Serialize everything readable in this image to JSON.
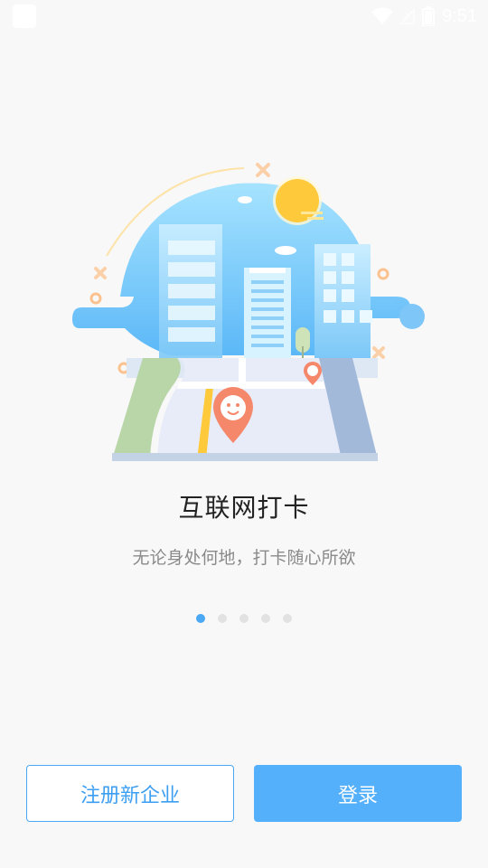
{
  "status_bar": {
    "time": "9:51",
    "icons": [
      "app-icon",
      "wifi-icon",
      "no-signal-icon",
      "battery-icon"
    ]
  },
  "onboarding": {
    "illustration": "map-check-in-illustration",
    "title": "互联网打卡",
    "subtitle": "无论身处何地，打卡随心所欲",
    "page_indicator": {
      "current": 1,
      "total": 5
    }
  },
  "actions": {
    "register_label": "注册新企业",
    "login_label": "登录"
  },
  "colors": {
    "accent": "#4aa8f5",
    "login_bg": "#55b0fb",
    "sky": "#8fd3ff",
    "sun": "#ffc93c",
    "pin": "#f5876b"
  }
}
